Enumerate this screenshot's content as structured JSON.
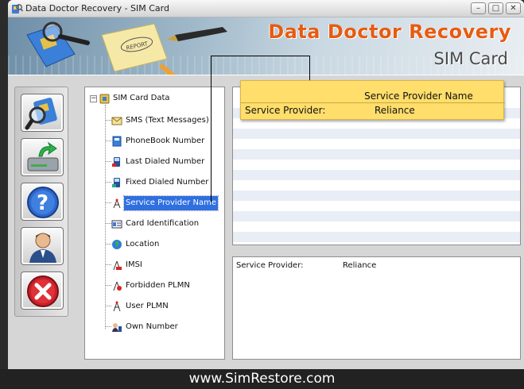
{
  "window": {
    "title": "Data Doctor Recovery - SIM Card",
    "minimize_glyph": "–",
    "maximize_glyph": "□",
    "close_glyph": "✕"
  },
  "banner": {
    "brand": "Data Doctor Recovery",
    "product": "SIM Card",
    "report_stamp": "REPORT"
  },
  "sidebar": {
    "buttons": [
      {
        "name": "search-sim-button",
        "icon": "sim-magnifier-icon"
      },
      {
        "name": "save-button",
        "icon": "drive-save-icon"
      },
      {
        "name": "help-button",
        "icon": "question-icon"
      },
      {
        "name": "about-button",
        "icon": "user-icon"
      },
      {
        "name": "exit-button",
        "icon": "close-icon"
      }
    ]
  },
  "tree": {
    "expander": "−",
    "root": "SIM Card Data",
    "items": [
      {
        "label": "SMS (Text Messages)",
        "icon": "envelope-icon"
      },
      {
        "label": "PhoneBook Number",
        "icon": "phonebook-icon"
      },
      {
        "label": "Last Dialed Number",
        "icon": "phone-icon"
      },
      {
        "label": "Fixed Dialed Number",
        "icon": "phone-fixed-icon"
      },
      {
        "label": "Service Provider Name",
        "icon": "antenna-icon"
      },
      {
        "label": "Card Identification",
        "icon": "id-card-icon"
      },
      {
        "label": "Location",
        "icon": "globe-icon"
      },
      {
        "label": "IMSI",
        "icon": "tower-icon"
      },
      {
        "label": "Forbidden PLMN",
        "icon": "tower-forbidden-icon"
      },
      {
        "label": "User PLMN",
        "icon": "tower-user-icon"
      },
      {
        "label": "Own Number",
        "icon": "person-phone-icon"
      }
    ],
    "selected": "Service Provider Name"
  },
  "grid_popup": {
    "header": "Service Provider Name",
    "key": "Service Provider:",
    "value": "Reliance"
  },
  "details": {
    "key": "Service Provider:",
    "value": "Reliance"
  },
  "footer": {
    "url": "www.SimRestore.com"
  },
  "colors": {
    "brand": "#e65c12",
    "selection": "#2f6fe0",
    "tooltip": "#ffde6b",
    "grid_alt_row": "#e9edf5"
  }
}
